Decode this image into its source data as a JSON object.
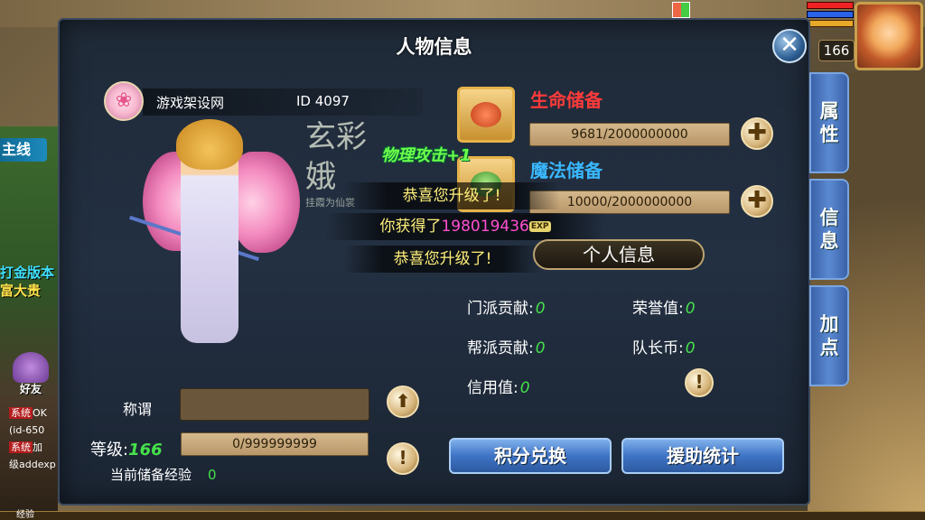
{
  "hud": {
    "level": "166",
    "quest_tab": "主线",
    "promo_line1": "打金版本",
    "promo_line2": "富大贵",
    "friend_label": "好友",
    "chat": [
      {
        "tag": "系统",
        "text": "OK"
      },
      {
        "tag": "",
        "text": "(id-650"
      },
      {
        "tag": "系统",
        "text": "加"
      },
      {
        "tag": "",
        "text": "级addexp"
      }
    ],
    "exp_label": "经验"
  },
  "panel": {
    "title": "人物信息",
    "tabs": [
      {
        "label": "属\n性"
      },
      {
        "label": "信\n息"
      },
      {
        "label": "加\n点"
      }
    ]
  },
  "identity": {
    "name": "游戏架设网",
    "id": "ID 4097"
  },
  "calligraphy": {
    "main": "玄彩娥",
    "small": "挂霞为仙裳"
  },
  "notifications": {
    "buff": "物理攻击+1",
    "levelup1": "恭喜您升级了!",
    "gain_prefix": "你获得了",
    "gain_value": "198019436",
    "exp_tag": "EXP",
    "levelup2": "恭喜您升级了!"
  },
  "reserves": {
    "hp": {
      "title": "生命储备",
      "value": "9681/2000000000"
    },
    "mp": {
      "title": "魔法储备",
      "value": "10000/2000000000"
    }
  },
  "personal_button": "个人信息",
  "stats": {
    "sect_contrib": {
      "label": "门派贡献:",
      "value": "0"
    },
    "honor": {
      "label": "荣誉值:",
      "value": "0"
    },
    "guild_contrib": {
      "label": "帮派贡献:",
      "value": "0"
    },
    "captain_coin": {
      "label": "队长币:",
      "value": "0"
    },
    "credit": {
      "label": "信用值:",
      "value": "0"
    }
  },
  "title_row": {
    "label": "称谓",
    "value": ""
  },
  "level": {
    "label": "等级:",
    "value": "166",
    "exp": "0/999999999"
  },
  "stored_exp": {
    "label": "当前储备经验",
    "value": "0"
  },
  "buttons": {
    "exchange": "积分兑换",
    "assist_stats": "援助统计"
  },
  "icons": {
    "close": "✕",
    "plus": "✚",
    "alert": "!",
    "upload": "⬆"
  }
}
